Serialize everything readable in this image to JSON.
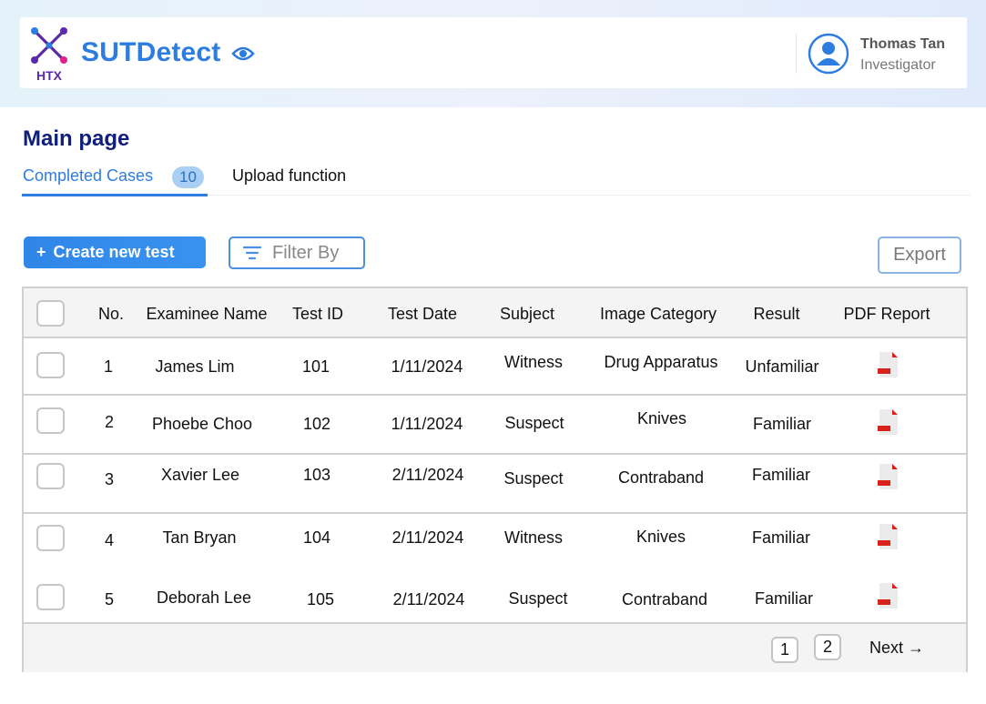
{
  "app": {
    "logo_text": "HTX",
    "brand": "SUTDetect"
  },
  "user": {
    "name": "Thomas Tan",
    "role": "Investigator"
  },
  "page": {
    "title": "Main page"
  },
  "tabs": [
    {
      "label": "Completed Cases",
      "badge": "10",
      "active": true
    },
    {
      "label": "Upload function",
      "active": false
    }
  ],
  "toolbar": {
    "create_label": "Create new test",
    "create_icon": "+",
    "filter_label": "Filter By",
    "export_label": "Export"
  },
  "table": {
    "columns": [
      "No.",
      "Examinee Name",
      "Test ID",
      "Test Date",
      "Subject",
      "Image Category",
      "Result",
      "PDF Report"
    ],
    "rows": [
      {
        "no": "1",
        "name": "James Lim",
        "test_id": "101",
        "date": "1/11/2024",
        "subject": "Witness",
        "category": "Drug Apparatus",
        "result": "Unfamiliar"
      },
      {
        "no": "2",
        "name": "Phoebe Choo",
        "test_id": "102",
        "date": "1/11/2024",
        "subject": "Suspect",
        "category": "Knives",
        "result": "Familiar"
      },
      {
        "no": "3",
        "name": "Xavier Lee",
        "test_id": "103",
        "date": "2/11/2024",
        "subject": "Suspect",
        "category": "Contraband",
        "result": "Familiar"
      },
      {
        "no": "4",
        "name": "Tan Bryan",
        "test_id": "104",
        "date": "2/11/2024",
        "subject": "Witness",
        "category": "Knives",
        "result": "Familiar"
      },
      {
        "no": "5",
        "name": "Deborah Lee",
        "test_id": "105",
        "date": "2/11/2024",
        "subject": "Suspect",
        "category": "Contraband",
        "result": "Familiar"
      }
    ]
  },
  "pagination": {
    "pages": [
      "1",
      "2"
    ],
    "next_label": "Next →"
  },
  "colors": {
    "accent": "#2d7de0",
    "title": "#0f1f7a",
    "badge_bg": "#a9d0f4",
    "pdf_red": "#d8231c"
  }
}
